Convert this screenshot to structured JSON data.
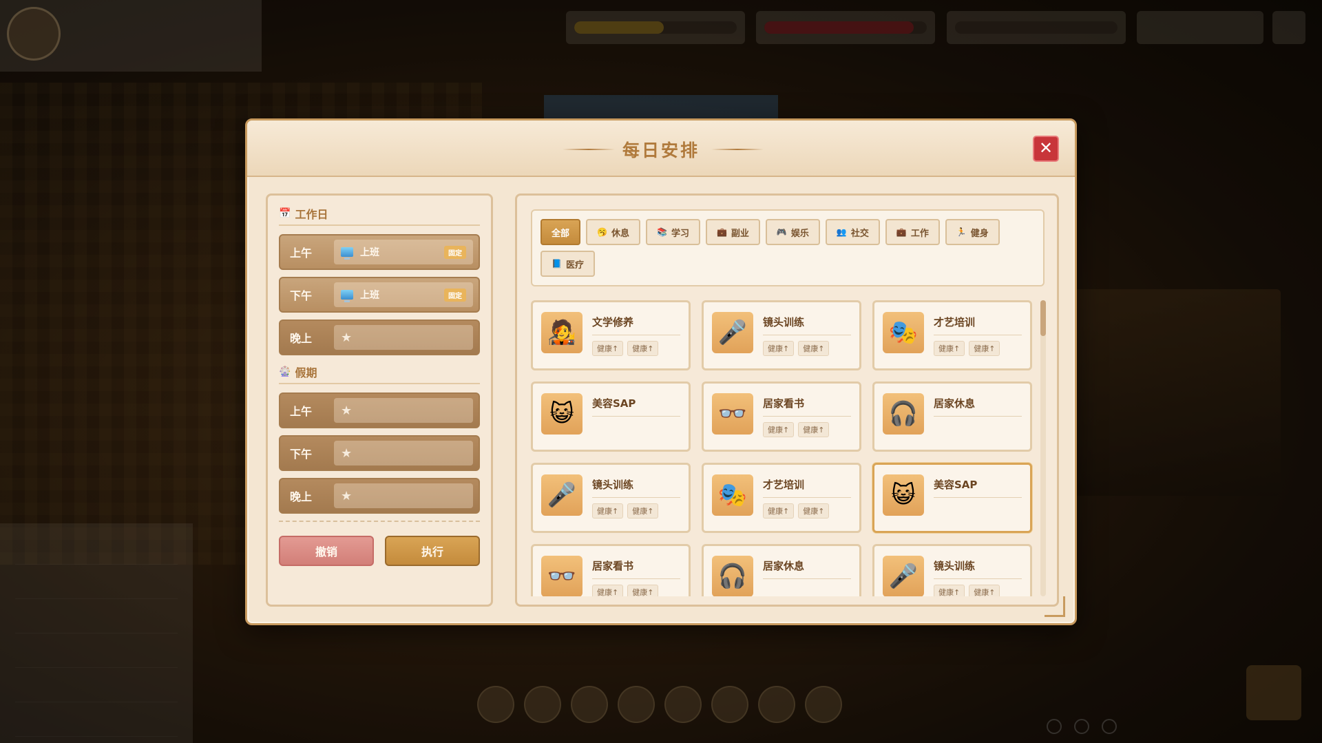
{
  "modal": {
    "title": "每日安排",
    "close_symbol": "✕"
  },
  "schedule": {
    "workday": {
      "title": "工作日",
      "slots": [
        {
          "time": "上午",
          "activity": "上班",
          "tag": "固定"
        },
        {
          "time": "下午",
          "activity": "上班",
          "tag": "固定"
        },
        {
          "time": "晚上",
          "activity": "★",
          "tag": ""
        }
      ]
    },
    "holiday": {
      "title": "假期",
      "slots": [
        {
          "time": "上午",
          "activity": "★"
        },
        {
          "time": "下午",
          "activity": "★"
        },
        {
          "time": "晚上",
          "activity": "★"
        }
      ]
    },
    "cancel_label": "撤销",
    "execute_label": "执行"
  },
  "filters": [
    {
      "label": "全部",
      "icon": "",
      "active": true
    },
    {
      "label": "休息",
      "icon": "🥱",
      "active": false
    },
    {
      "label": "学习",
      "icon": "📚",
      "active": false
    },
    {
      "label": "副业",
      "icon": "💼",
      "active": false
    },
    {
      "label": "娱乐",
      "icon": "🎮",
      "active": false
    },
    {
      "label": "社交",
      "icon": "👥",
      "active": false
    },
    {
      "label": "工作",
      "icon": "💼",
      "active": false
    },
    {
      "label": "健身",
      "icon": "🏃",
      "active": false
    },
    {
      "label": "医疗",
      "icon": "📘",
      "active": false
    }
  ],
  "activities": [
    {
      "name": "文学修养",
      "icon": "🧑‍🎤",
      "tags": [
        "健康↑",
        "健康↑"
      ]
    },
    {
      "name": "镜头训练",
      "icon": "🎤",
      "tags": [
        "健康↑",
        "健康↑"
      ]
    },
    {
      "name": "才艺培训",
      "icon": "🎭",
      "tags": [
        "健康↑",
        "健康↑"
      ]
    },
    {
      "name": "美容SAP",
      "icon": "😺",
      "tags": []
    },
    {
      "name": "居家看书",
      "icon": "👓",
      "tags": [
        "健康↑",
        "健康↑"
      ]
    },
    {
      "name": "居家休息",
      "icon": "🎧",
      "tags": []
    },
    {
      "name": "镜头训练",
      "icon": "🎤",
      "tags": [
        "健康↑",
        "健康↑"
      ]
    },
    {
      "name": "才艺培训",
      "icon": "🎭",
      "tags": [
        "健康↑",
        "健康↑"
      ]
    },
    {
      "name": "美容SAP",
      "icon": "😺",
      "tags": [],
      "selected": true
    },
    {
      "name": "居家看书",
      "icon": "👓",
      "tags": [
        "健康↑",
        "健康↑"
      ]
    },
    {
      "name": "居家休息",
      "icon": "🎧",
      "tags": []
    },
    {
      "name": "镜头训练",
      "icon": "🎤",
      "tags": [
        "健康↑",
        "健康↑"
      ]
    }
  ],
  "colors": {
    "accent": "#c48b3c",
    "close": "#c8353a",
    "panel": "#f6e9d8"
  }
}
